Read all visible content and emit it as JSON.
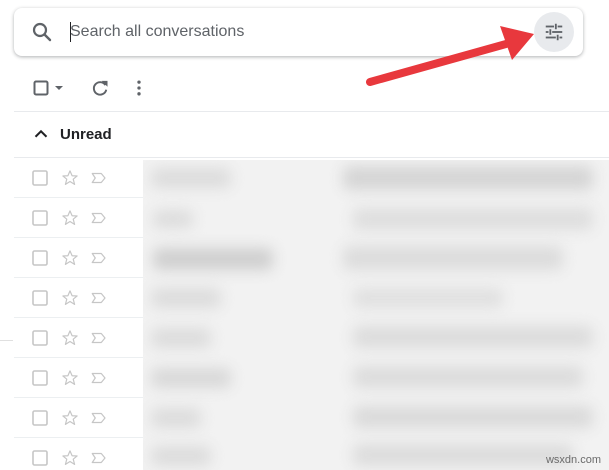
{
  "search": {
    "placeholder": "Search all conversations",
    "value": ""
  },
  "icons": {
    "search": "search-icon",
    "options": "sliders-icon",
    "select": "checkbox-icon",
    "refresh": "refresh-icon",
    "more": "more-vert-icon",
    "collapse": "chevron-up-icon",
    "star": "star-icon",
    "important": "label-icon"
  },
  "section": {
    "title": "Unread",
    "rows": [
      {
        "index": 1
      },
      {
        "index": 2
      },
      {
        "index": 3
      },
      {
        "index": 4
      },
      {
        "index": 5
      },
      {
        "index": 6
      },
      {
        "index": 7
      },
      {
        "index": 8
      }
    ]
  },
  "annotation": {
    "color": "#e8383d"
  },
  "watermark": "wsxdn.com"
}
